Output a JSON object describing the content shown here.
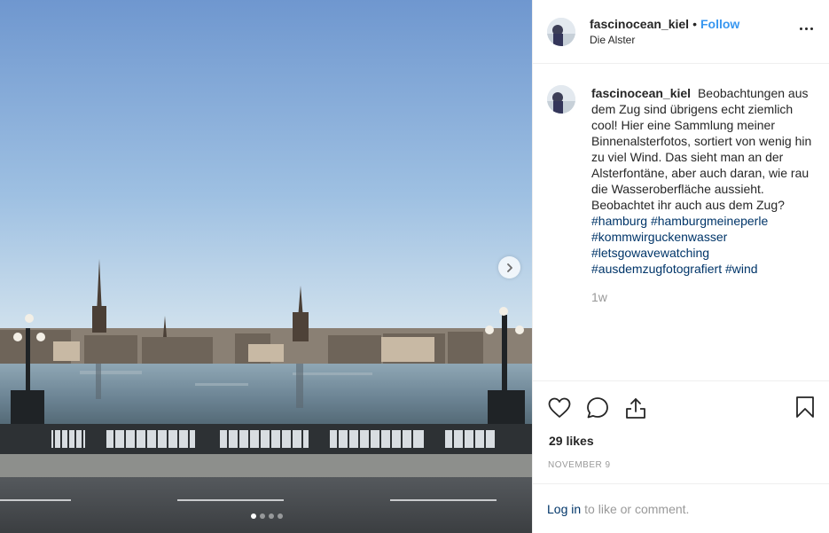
{
  "post": {
    "username": "fascinocean_kiel",
    "separator": "•",
    "follow_label": "Follow",
    "location": "Die Alster",
    "more_icon": "more-options-icon"
  },
  "caption": {
    "username": "fascinocean_kiel",
    "text": "Beobachtungen aus dem Zug sind übrigens echt ziemlich cool! Hier eine Sammlung meiner Binnenalsterfotos, sortiert von wenig hin zu viel Wind. Das sieht man an der Alsterfontäne, aber auch daran, wie rau die Wasseroberfläche aussieht. Beobachtet ihr auch aus dem Zug?",
    "hashtags": [
      "#hamburg",
      "#hamburgmeineperle",
      "#kommwirguckenwasser",
      "#letsgowavewatching",
      "#ausdemzugfotografiert",
      "#wind"
    ],
    "time": "1w"
  },
  "actions": {
    "like_icon": "heart-icon",
    "comment_icon": "comment-icon",
    "share_icon": "share-icon",
    "save_icon": "bookmark-icon"
  },
  "likes": "29 likes",
  "date": "November 9",
  "footer": {
    "login_label": "Log in",
    "rest": "to like or comment."
  },
  "carousel": {
    "slide_count": 4,
    "active_slide": 1
  },
  "colors": {
    "link_blue": "#3897f0",
    "tag_blue": "#003569",
    "muted": "#999999",
    "text": "#262626"
  }
}
